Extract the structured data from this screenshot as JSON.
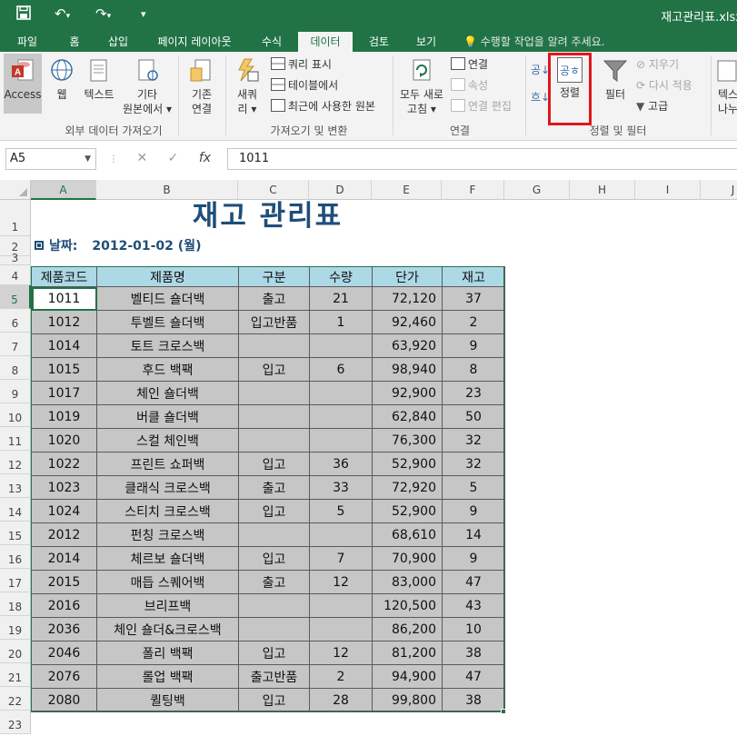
{
  "window": {
    "title": "재고관리표.xlsx"
  },
  "quick_access": {
    "save_icon": "save-icon",
    "undo_icon": "undo-icon",
    "redo_icon": "redo-icon",
    "more_icon": "customize-icon"
  },
  "tabs": [
    {
      "label": "파일",
      "active": false
    },
    {
      "label": "홈",
      "active": false
    },
    {
      "label": "삽입",
      "active": false
    },
    {
      "label": "페이지 레이아웃",
      "active": false
    },
    {
      "label": "수식",
      "active": false
    },
    {
      "label": "데이터",
      "active": true
    },
    {
      "label": "검토",
      "active": false
    },
    {
      "label": "보기",
      "active": false
    }
  ],
  "tell_me": "수행할 작업을 알려 주세요.",
  "ribbon": {
    "external": {
      "access": "Access",
      "web": "웹",
      "text": "텍스트",
      "other_line1": "기타",
      "other_line2": "원본에서 ▾",
      "existing_line1": "기존",
      "existing_line2": "연결",
      "group_label": "외부 데이터 가져오기"
    },
    "gettransform": {
      "newquery_line1": "새쿼",
      "newquery_line2": "리 ▾",
      "show_query": "쿼리 표시",
      "from_table": "테이블에서",
      "recent_sources": "최근에 사용한 원본",
      "group_label": "가져오기 및 변환"
    },
    "connections": {
      "refresh_line1": "모두 새로",
      "refresh_line2": "고침 ▾",
      "connections": "연결",
      "properties": "속성",
      "edit_links": "연결 편집",
      "group_label": "연결"
    },
    "sortfilter": {
      "sort": "정렬",
      "filter": "필터",
      "clear": "지우기",
      "reapply": "다시 적용",
      "advanced": "고급",
      "group_label": "정렬 및 필터",
      "sort_icon_text": "공ㅎ"
    },
    "datatools": {
      "text_to_columns_line1": "텍스",
      "text_to_columns_line2": "나누"
    }
  },
  "formula_bar": {
    "name_box": "A5",
    "value": "1011",
    "fx": "fx"
  },
  "columns": [
    "A",
    "B",
    "C",
    "D",
    "E",
    "F",
    "G",
    "H",
    "I",
    "J"
  ],
  "rows": [
    "1",
    "2",
    "3",
    "4",
    "5",
    "6",
    "7",
    "8",
    "9",
    "10",
    "11",
    "12",
    "13",
    "14",
    "15",
    "16",
    "17",
    "18",
    "19",
    "20",
    "21",
    "22",
    "23"
  ],
  "sheet": {
    "title": "재고 관리표",
    "date_label": "날짜:",
    "date_value": "2012-01-02 (월)",
    "headers": [
      "제품코드",
      "제품명",
      "구분",
      "수량",
      "단가",
      "재고"
    ],
    "rows": [
      [
        "1011",
        "벨티드 숄더백",
        "출고",
        "21",
        "72,120",
        "37"
      ],
      [
        "1012",
        "투벨트 숄더백",
        "입고반품",
        "1",
        "92,460",
        "2"
      ],
      [
        "1014",
        "토트 크로스백",
        "",
        "",
        "63,920",
        "9"
      ],
      [
        "1015",
        "후드 백팩",
        "입고",
        "6",
        "98,940",
        "8"
      ],
      [
        "1017",
        "체인 숄더백",
        "",
        "",
        "92,900",
        "23"
      ],
      [
        "1019",
        "버클 숄더백",
        "",
        "",
        "62,840",
        "50"
      ],
      [
        "1020",
        "스컬 체인백",
        "",
        "",
        "76,300",
        "32"
      ],
      [
        "1022",
        "프린트 쇼퍼백",
        "입고",
        "36",
        "52,900",
        "32"
      ],
      [
        "1023",
        "클래식 크로스백",
        "출고",
        "33",
        "72,920",
        "5"
      ],
      [
        "1024",
        "스티치 크로스백",
        "입고",
        "5",
        "52,900",
        "9"
      ],
      [
        "2012",
        "펀칭 크로스백",
        "",
        "",
        "68,610",
        "14"
      ],
      [
        "2014",
        "체르보 숄더백",
        "입고",
        "7",
        "70,900",
        "9"
      ],
      [
        "2015",
        "매듭 스퀘어백",
        "출고",
        "12",
        "83,000",
        "47"
      ],
      [
        "2016",
        "브리프백",
        "",
        "",
        "120,500",
        "43"
      ],
      [
        "2036",
        "체인 숄더&크로스백",
        "",
        "",
        "86,200",
        "10"
      ],
      [
        "2046",
        "폴리 백팩",
        "입고",
        "12",
        "81,200",
        "38"
      ],
      [
        "2076",
        "롤업 백팩",
        "출고반품",
        "2",
        "94,900",
        "47"
      ],
      [
        "2080",
        "퀼팅백",
        "입고",
        "28",
        "99,800",
        "38"
      ]
    ]
  }
}
